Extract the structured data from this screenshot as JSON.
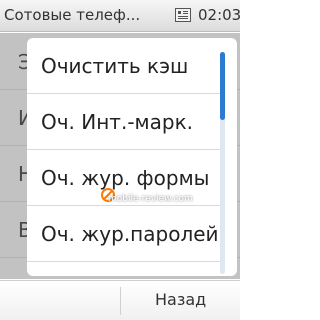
{
  "status_bar": {
    "title": "Сотовые телеф...",
    "time": "02:03",
    "mail_icon": "message-icon"
  },
  "background_list": {
    "items": [
      {
        "label": "Эт"
      },
      {
        "label": "Ин"
      },
      {
        "label": "На"
      },
      {
        "label": "Вы"
      }
    ]
  },
  "menu": {
    "items": [
      {
        "label": "Очистить кэш"
      },
      {
        "label": "Оч. Инт.-марк."
      },
      {
        "label": "Оч. жур. формы"
      },
      {
        "label": "Оч. жур.паролей"
      }
    ]
  },
  "bottom_bar": {
    "back_label": "Назад"
  },
  "watermark": {
    "text": "mobile-review.com"
  },
  "colors": {
    "accent": "#2b7bd0",
    "overlay": "#787878"
  }
}
